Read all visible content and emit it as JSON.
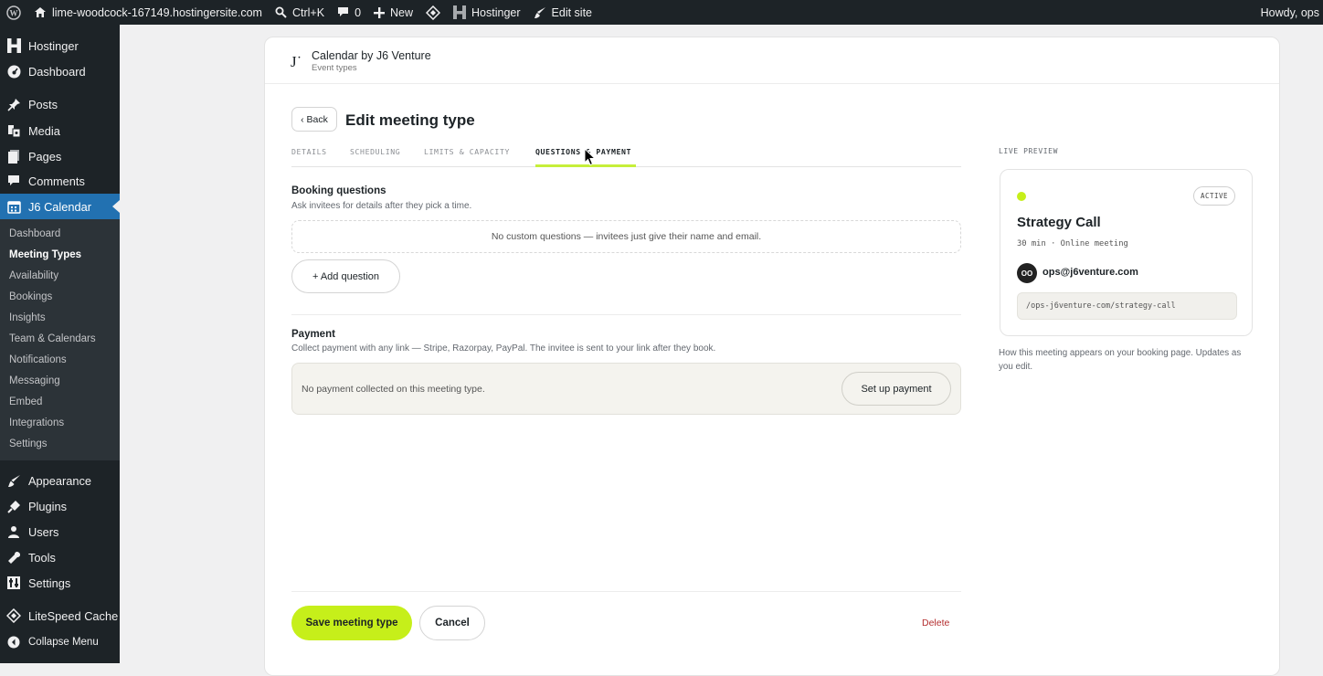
{
  "adminbar": {
    "site_name": "lime-woodcock-167149.hostingersite.com",
    "search_shortcut": "Ctrl+K",
    "comments_count": "0",
    "new_label": "New",
    "hostinger_label": "Hostinger",
    "edit_site_label": "Edit site",
    "howdy": "Howdy, ops"
  },
  "sidebar": {
    "top_items": [
      {
        "label": "Hostinger",
        "icon": "hostinger-icon"
      },
      {
        "label": "Dashboard",
        "icon": "dashboard-icon"
      },
      {
        "label": "Posts",
        "icon": "pin-icon"
      },
      {
        "label": "Media",
        "icon": "media-icon"
      },
      {
        "label": "Pages",
        "icon": "pages-icon"
      },
      {
        "label": "Comments",
        "icon": "comment-icon"
      },
      {
        "label": "J6 Calendar",
        "icon": "calendar-icon"
      }
    ],
    "sub_items": [
      "Dashboard",
      "Meeting Types",
      "Availability",
      "Bookings",
      "Insights",
      "Team & Calendars",
      "Notifications",
      "Messaging",
      "Embed",
      "Integrations",
      "Settings"
    ],
    "bottom_items": [
      {
        "label": "Appearance",
        "icon": "brush-icon"
      },
      {
        "label": "Plugins",
        "icon": "plugin-icon"
      },
      {
        "label": "Users",
        "icon": "user-icon"
      },
      {
        "label": "Tools",
        "icon": "wrench-icon"
      },
      {
        "label": "Settings",
        "icon": "settings-icon"
      },
      {
        "label": "LiteSpeed Cache",
        "icon": "diamond-icon"
      },
      {
        "label": "Collapse Menu",
        "icon": "collapse-icon"
      }
    ]
  },
  "header": {
    "logo": "J˙",
    "title": "Calendar by J6 Venture",
    "subtitle": "Event types"
  },
  "page": {
    "back_label": "‹ Back",
    "heading": "Edit meeting type"
  },
  "tabs": [
    {
      "label": "DETAILS",
      "active": false
    },
    {
      "label": "SCHEDULING",
      "active": false
    },
    {
      "label": "LIMITS & CAPACITY",
      "active": false
    },
    {
      "label": "QUESTIONS & PAYMENT",
      "active": true
    }
  ],
  "booking_questions": {
    "title": "Booking questions",
    "description": "Ask invitees for details after they pick a time.",
    "empty_text": "No custom questions — invitees just give their name and email.",
    "add_label": "+ Add question"
  },
  "payment": {
    "title": "Payment",
    "description": "Collect payment with any link — Stripe, Razorpay, PayPal. The invitee is sent to your link after they book.",
    "status_text": "No payment collected on this meeting type.",
    "setup_label": "Set up payment"
  },
  "footer": {
    "save_label": "Save meeting type",
    "cancel_label": "Cancel",
    "delete_label": "Delete"
  },
  "preview": {
    "section_label": "LIVE PREVIEW",
    "status": "ACTIVE",
    "title": "Strategy Call",
    "meta": "30 min · Online meeting",
    "avatar_initials": "OO",
    "email": "ops@j6venture.com",
    "url": "/ops-j6venture-com/strategy-call",
    "note": "How this meeting appears on your booking page. Updates as you edit."
  },
  "colors": {
    "accent": "#c6ef1a",
    "admin_dark": "#1d2327",
    "active_menu": "#2271b1",
    "delete": "#b32d2e"
  }
}
